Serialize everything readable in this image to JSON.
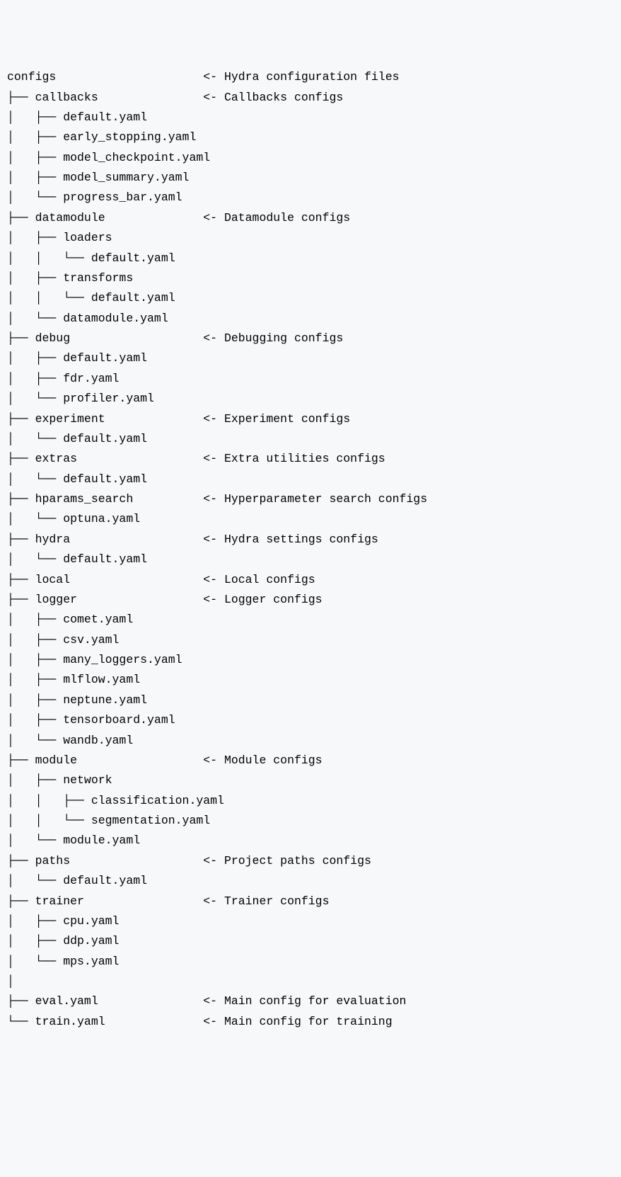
{
  "lines": [
    {
      "tree": "configs                     ",
      "comment": "<- Hydra configuration files"
    },
    {
      "tree": "├── callbacks               ",
      "comment": "<- Callbacks configs"
    },
    {
      "tree": "│   ├── default.yaml",
      "comment": ""
    },
    {
      "tree": "│   ├── early_stopping.yaml",
      "comment": ""
    },
    {
      "tree": "│   ├── model_checkpoint.yaml",
      "comment": ""
    },
    {
      "tree": "│   ├── model_summary.yaml",
      "comment": ""
    },
    {
      "tree": "│   └── progress_bar.yaml",
      "comment": ""
    },
    {
      "tree": "├── datamodule              ",
      "comment": "<- Datamodule configs"
    },
    {
      "tree": "│   ├── loaders",
      "comment": ""
    },
    {
      "tree": "│   │   └── default.yaml",
      "comment": ""
    },
    {
      "tree": "│   ├── transforms",
      "comment": ""
    },
    {
      "tree": "│   │   └── default.yaml",
      "comment": ""
    },
    {
      "tree": "│   └── datamodule.yaml",
      "comment": ""
    },
    {
      "tree": "├── debug                   ",
      "comment": "<- Debugging configs"
    },
    {
      "tree": "│   ├── default.yaml",
      "comment": ""
    },
    {
      "tree": "│   ├── fdr.yaml",
      "comment": ""
    },
    {
      "tree": "│   └── profiler.yaml",
      "comment": ""
    },
    {
      "tree": "├── experiment              ",
      "comment": "<- Experiment configs"
    },
    {
      "tree": "│   └── default.yaml",
      "comment": ""
    },
    {
      "tree": "├── extras                  ",
      "comment": "<- Extra utilities configs"
    },
    {
      "tree": "│   └── default.yaml",
      "comment": ""
    },
    {
      "tree": "├── hparams_search          ",
      "comment": "<- Hyperparameter search configs"
    },
    {
      "tree": "│   └── optuna.yaml",
      "comment": ""
    },
    {
      "tree": "├── hydra                   ",
      "comment": "<- Hydra settings configs"
    },
    {
      "tree": "│   └── default.yaml",
      "comment": ""
    },
    {
      "tree": "├── local                   ",
      "comment": "<- Local configs"
    },
    {
      "tree": "├── logger                  ",
      "comment": "<- Logger configs"
    },
    {
      "tree": "│   ├── comet.yaml",
      "comment": ""
    },
    {
      "tree": "│   ├── csv.yaml",
      "comment": ""
    },
    {
      "tree": "│   ├── many_loggers.yaml",
      "comment": ""
    },
    {
      "tree": "│   ├── mlflow.yaml",
      "comment": ""
    },
    {
      "tree": "│   ├── neptune.yaml",
      "comment": ""
    },
    {
      "tree": "│   ├── tensorboard.yaml",
      "comment": ""
    },
    {
      "tree": "│   └── wandb.yaml",
      "comment": ""
    },
    {
      "tree": "├── module                  ",
      "comment": "<- Module configs"
    },
    {
      "tree": "│   ├── network",
      "comment": ""
    },
    {
      "tree": "│   │   ├── classification.yaml",
      "comment": ""
    },
    {
      "tree": "│   │   └── segmentation.yaml",
      "comment": ""
    },
    {
      "tree": "│   └── module.yaml",
      "comment": ""
    },
    {
      "tree": "├── paths                   ",
      "comment": "<- Project paths configs"
    },
    {
      "tree": "│   └── default.yaml",
      "comment": ""
    },
    {
      "tree": "├── trainer                 ",
      "comment": "<- Trainer configs"
    },
    {
      "tree": "│   ├── cpu.yaml",
      "comment": ""
    },
    {
      "tree": "│   ├── ddp.yaml",
      "comment": ""
    },
    {
      "tree": "│   └── mps.yaml",
      "comment": ""
    },
    {
      "tree": "│",
      "comment": ""
    },
    {
      "tree": "├── eval.yaml               ",
      "comment": "<- Main config for evaluation"
    },
    {
      "tree": "└── train.yaml              ",
      "comment": "<- Main config for training"
    }
  ]
}
